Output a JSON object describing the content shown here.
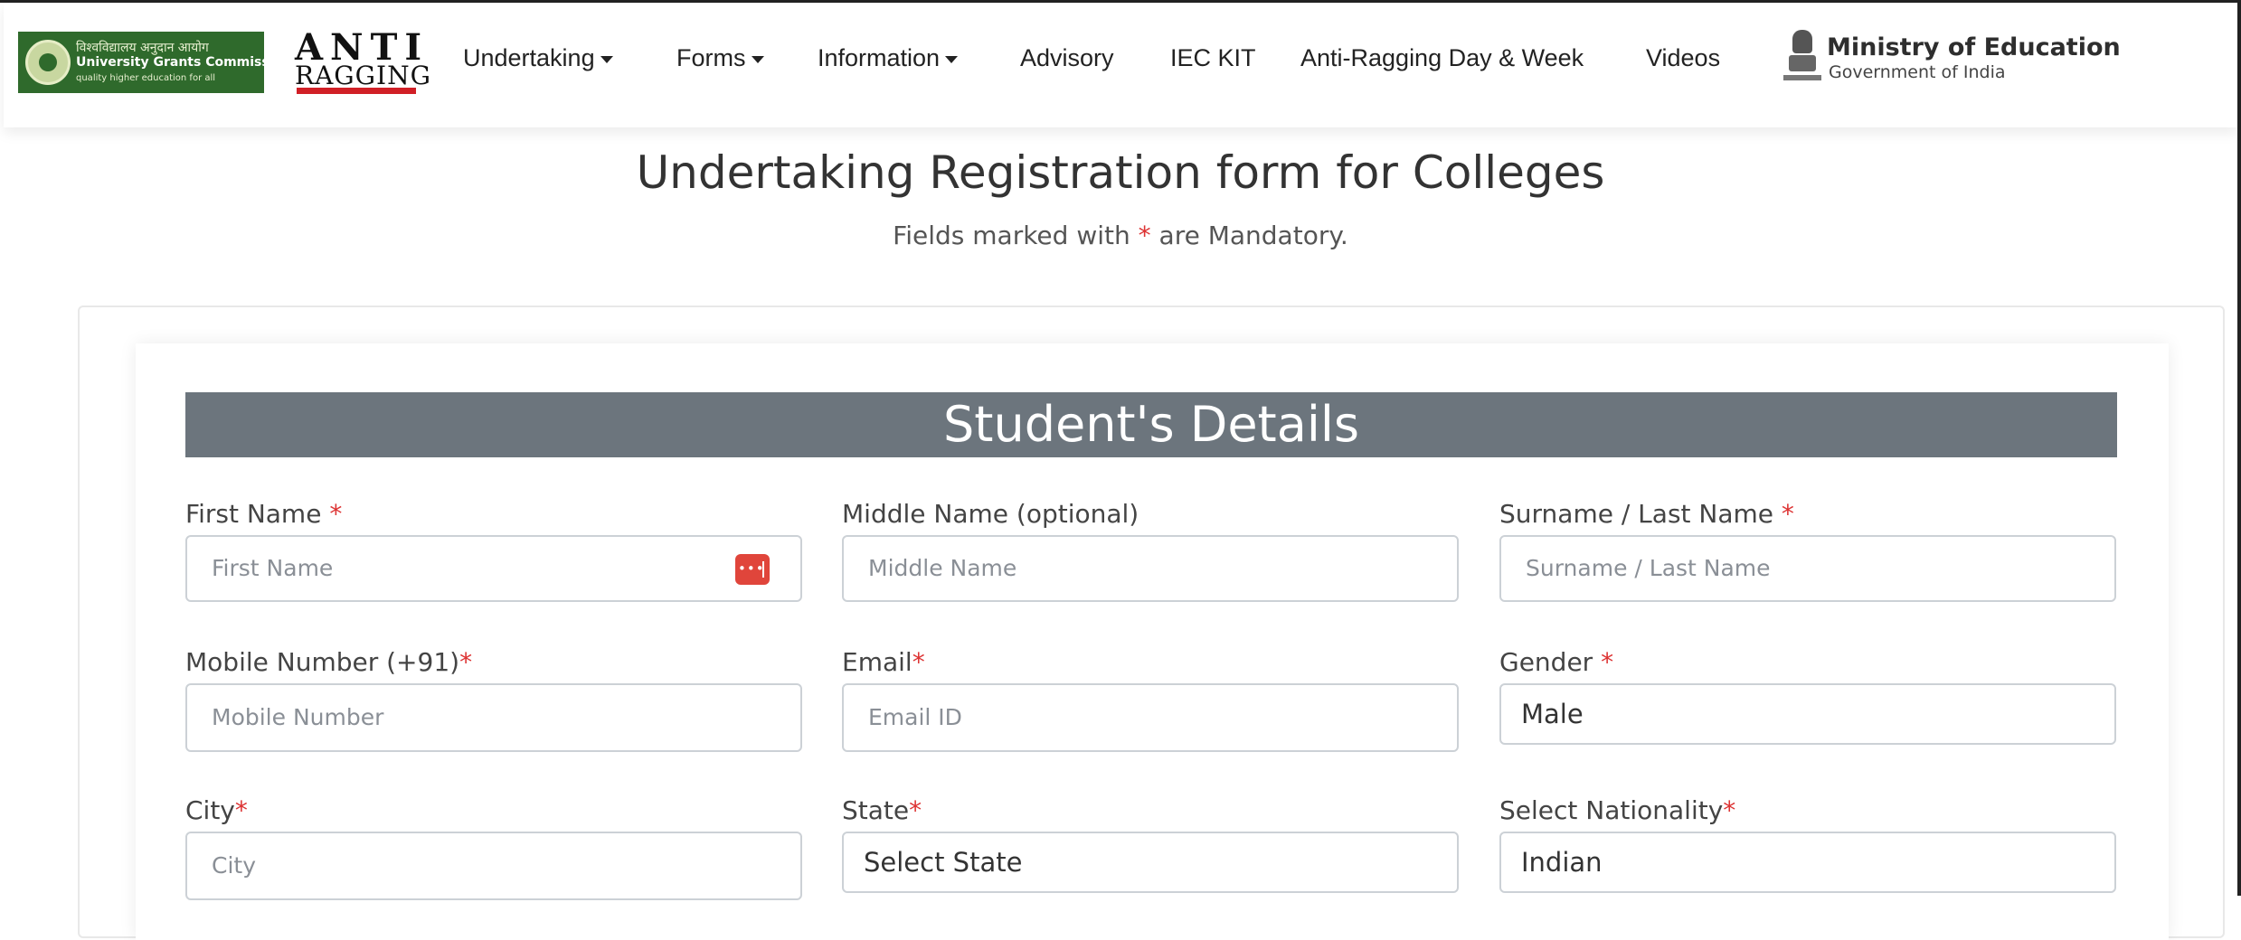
{
  "header": {
    "ugc_logo": {
      "line1": "विश्वविद्यालय अनुदान आयोग",
      "line2": "University Grants Commission",
      "line3": "quality higher education for all"
    },
    "antiragging_logo": {
      "top": "ANTI",
      "bottom": "RAGGING"
    },
    "nav": {
      "undertaking": "Undertaking",
      "forms": "Forms",
      "information": "Information",
      "advisory": "Advisory",
      "iec_kit": "IEC KIT",
      "day_week": "Anti-Ragging Day & Week",
      "videos": "Videos"
    },
    "moe": {
      "title": "Ministry of Education",
      "subtitle": "Government of India"
    }
  },
  "page": {
    "title": "Undertaking Registration form for Colleges",
    "subtitle_before": "Fields marked with ",
    "subtitle_star": "*",
    "subtitle_after": " are Mandatory."
  },
  "section": {
    "title": "Student's Details"
  },
  "fields": {
    "first_name": {
      "label": "First Name ",
      "star": "*",
      "placeholder": "First Name"
    },
    "middle_name": {
      "label": "Middle Name (optional)",
      "placeholder": "Middle Name"
    },
    "surname": {
      "label": "Surname / Last Name ",
      "star": "*",
      "placeholder": "Surname / Last Name"
    },
    "mobile": {
      "label": "Mobile Number (+91)",
      "star": "*",
      "placeholder": "Mobile Number"
    },
    "email": {
      "label": "Email",
      "star": "*",
      "placeholder": "Email ID"
    },
    "gender": {
      "label": "Gender ",
      "star": "*",
      "value": "Male"
    },
    "city": {
      "label": "City",
      "star": "*",
      "placeholder": "City"
    },
    "state": {
      "label": "State",
      "star": "*",
      "value": "Select State"
    },
    "nationality": {
      "label": "Select Nationality",
      "star": "*",
      "value": "Indian"
    }
  },
  "colors": {
    "banner": "#6c757d",
    "required": "#dd3333",
    "ugc_green": "#2f6a2c",
    "brand_red": "#d11f26"
  }
}
